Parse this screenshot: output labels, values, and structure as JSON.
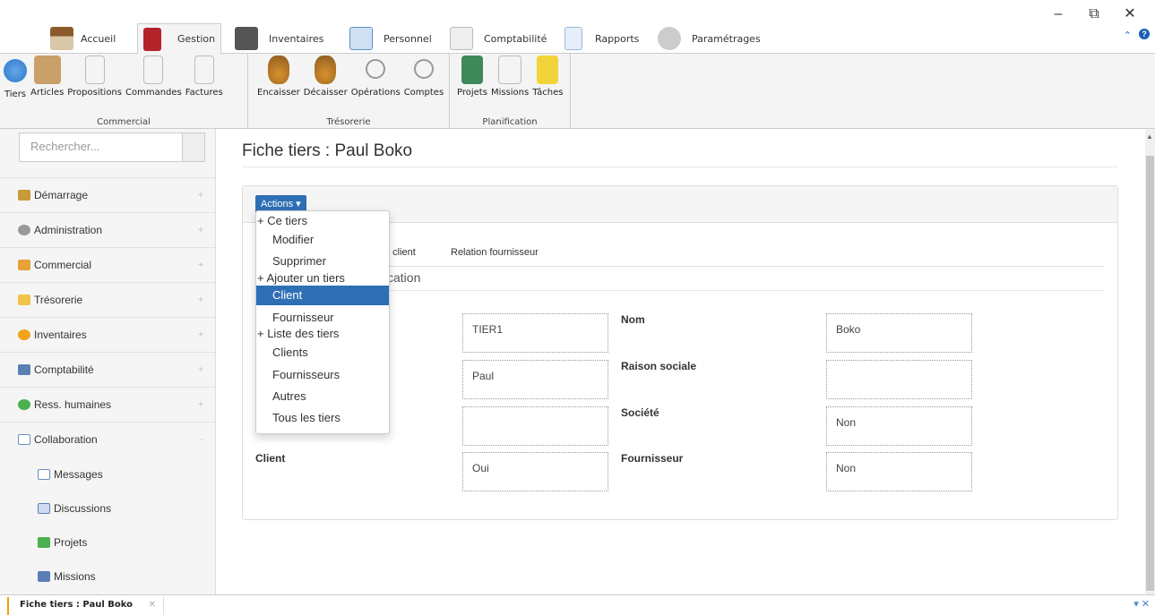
{
  "window": {
    "min": "–",
    "max": "⧉",
    "close": "✕"
  },
  "menu": {
    "tabs": [
      {
        "label": "Accueil",
        "icon": "house-icon",
        "color": "#8b5a2b"
      },
      {
        "label": "Gestion",
        "icon": "book-icon",
        "color": "#b3232a"
      },
      {
        "label": "Inventaires",
        "icon": "warehouse-icon",
        "color": "#555555"
      },
      {
        "label": "Personnel",
        "icon": "people-icon",
        "color": "#5b8fc7"
      },
      {
        "label": "Comptabilité",
        "icon": "ledger-icon",
        "color": "#3a7d3a"
      },
      {
        "label": "Rapports",
        "icon": "report-icon",
        "color": "#4b87c6"
      },
      {
        "label": "Paramétrages",
        "icon": "gear-icon",
        "color": "#aaaaaa"
      }
    ],
    "collapse": "ˆ",
    "help": "?"
  },
  "ribbon": {
    "groups": [
      {
        "label": "Commercial",
        "buttons": [
          {
            "label": "Tiers",
            "icon": "globe-icon",
            "color": "#2d77c9"
          },
          {
            "label": "Articles",
            "icon": "box-icon",
            "color": "#b8864b"
          },
          {
            "label": "Propositions",
            "icon": "document-icon",
            "color": "#e0e0e0"
          },
          {
            "label": "Commandes",
            "icon": "document-icon",
            "color": "#e0e0e0"
          },
          {
            "label": "Factures",
            "icon": "document-icon",
            "color": "#e0e0e0"
          }
        ]
      },
      {
        "label": "Trésorerie",
        "buttons": [
          {
            "label": "Encaisser",
            "icon": "moneybag-in-icon",
            "color": "#c9802a"
          },
          {
            "label": "Décaisser",
            "icon": "moneybag-out-icon",
            "color": "#c9802a"
          },
          {
            "label": "Opérations",
            "icon": "magnifier-icon",
            "color": "#d9d9d9"
          },
          {
            "label": "Comptes",
            "icon": "magnifier-icon",
            "color": "#d9d9d9"
          }
        ]
      },
      {
        "label": "Planification",
        "buttons": [
          {
            "label": "Projets",
            "icon": "projects-icon",
            "color": "#3e8a5a"
          },
          {
            "label": "Missions",
            "icon": "checklist-icon",
            "color": "#e0e0e0"
          },
          {
            "label": "Tâches",
            "icon": "sticky-note-icon",
            "color": "#f2d43a"
          }
        ]
      }
    ]
  },
  "sidebar": {
    "search_placeholder": "Rechercher...",
    "items": [
      {
        "label": "Démarrage",
        "icon": "home-icon",
        "color": "#c79a3a",
        "toggle": "+"
      },
      {
        "label": "Administration",
        "icon": "gear-icon",
        "color": "#888888",
        "toggle": "+"
      },
      {
        "label": "Commercial",
        "icon": "folder-icon",
        "color": "#e8a23a",
        "toggle": "+"
      },
      {
        "label": "Trésorerie",
        "icon": "folder-icon",
        "color": "#f2c34a",
        "toggle": "+"
      },
      {
        "label": "Inventaires",
        "icon": "coin-icon",
        "color": "#f2a31a",
        "toggle": "+"
      },
      {
        "label": "Comptabilité",
        "icon": "edit-icon",
        "color": "#5a7fb5",
        "toggle": "+"
      },
      {
        "label": "Ress. humaines",
        "icon": "people-icon",
        "color": "#4caf50",
        "toggle": "+"
      },
      {
        "label": "Collaboration",
        "icon": "mail-icon",
        "color": "#6a8fbf",
        "toggle": "-"
      }
    ],
    "subitems": [
      {
        "label": "Messages",
        "icon": "mail-icon",
        "color": "#6a8fbf"
      },
      {
        "label": "Discussions",
        "icon": "chat-icon",
        "color": "#5a7fb5"
      },
      {
        "label": "Projets",
        "icon": "puzzle-icon",
        "color": "#4caf50"
      },
      {
        "label": "Missions",
        "icon": "edit-icon",
        "color": "#5a7fb5"
      }
    ]
  },
  "main": {
    "title": "Fiche tiers : Paul Boko",
    "actions_label": "Actions ▾",
    "tabs": [
      "n client",
      "Relation fournisseur"
    ],
    "section": "cation",
    "fields": {
      "code": "TIER1",
      "nom_label": "Nom",
      "nom": "Boko",
      "prenom": "Paul",
      "raison_label": "Raison sociale",
      "raison": "",
      "societe_label": "Société",
      "blank": "",
      "societe": "Non",
      "client_label": "Client",
      "client": "Oui",
      "fournisseur_label": "Fournisseur",
      "fournisseur": "Non"
    }
  },
  "dropdown": {
    "ce_tiers": "+ Ce tiers",
    "modifier": "Modifier",
    "supprimer": "Supprimer",
    "ajouter": "+ Ajouter un tiers",
    "client": "Client",
    "fournisseur": "Fournisseur",
    "liste": "+ Liste des tiers",
    "clients": "Clients",
    "fournisseurs": "Fournisseurs",
    "autres": "Autres",
    "tous": "Tous les tiers"
  },
  "bottom": {
    "doc_tab": "Fiche tiers : Paul Boko",
    "close": "✕",
    "controls": "▾ ✕"
  }
}
